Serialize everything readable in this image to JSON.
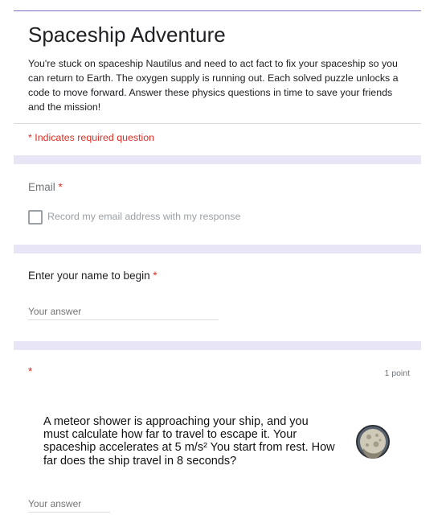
{
  "form": {
    "title": "Spaceship Adventure",
    "description": "You're stuck on spaceship Nautilus and need to act fact to fix your spaceship so you can return to Earth. The oxygen supply is running out. Each solved puzzle unlocks a code to move forward. Answer these physics questions in time to save your friends and the mission!",
    "required_note": "* Indicates required question"
  },
  "email_section": {
    "label": "Email",
    "required_mark": "*",
    "checkbox_label": "Record my email address with my response"
  },
  "name_question": {
    "label": "Enter your name to begin",
    "required_mark": "*",
    "placeholder": "Your answer"
  },
  "meteor_question": {
    "required_mark": "*",
    "points": "1 point",
    "text": "A meteor shower is approaching your ship, and you must calculate how far to travel to escape it. Your spaceship accelerates at 5 m/s²  You start from rest. How far does the ship travel in 8 seconds?",
    "image_icon": "moon-icon",
    "placeholder": "Your answer"
  },
  "colors": {
    "accent": "#7b6fc4",
    "band": "#e8e6f6",
    "required": "#d93025"
  }
}
